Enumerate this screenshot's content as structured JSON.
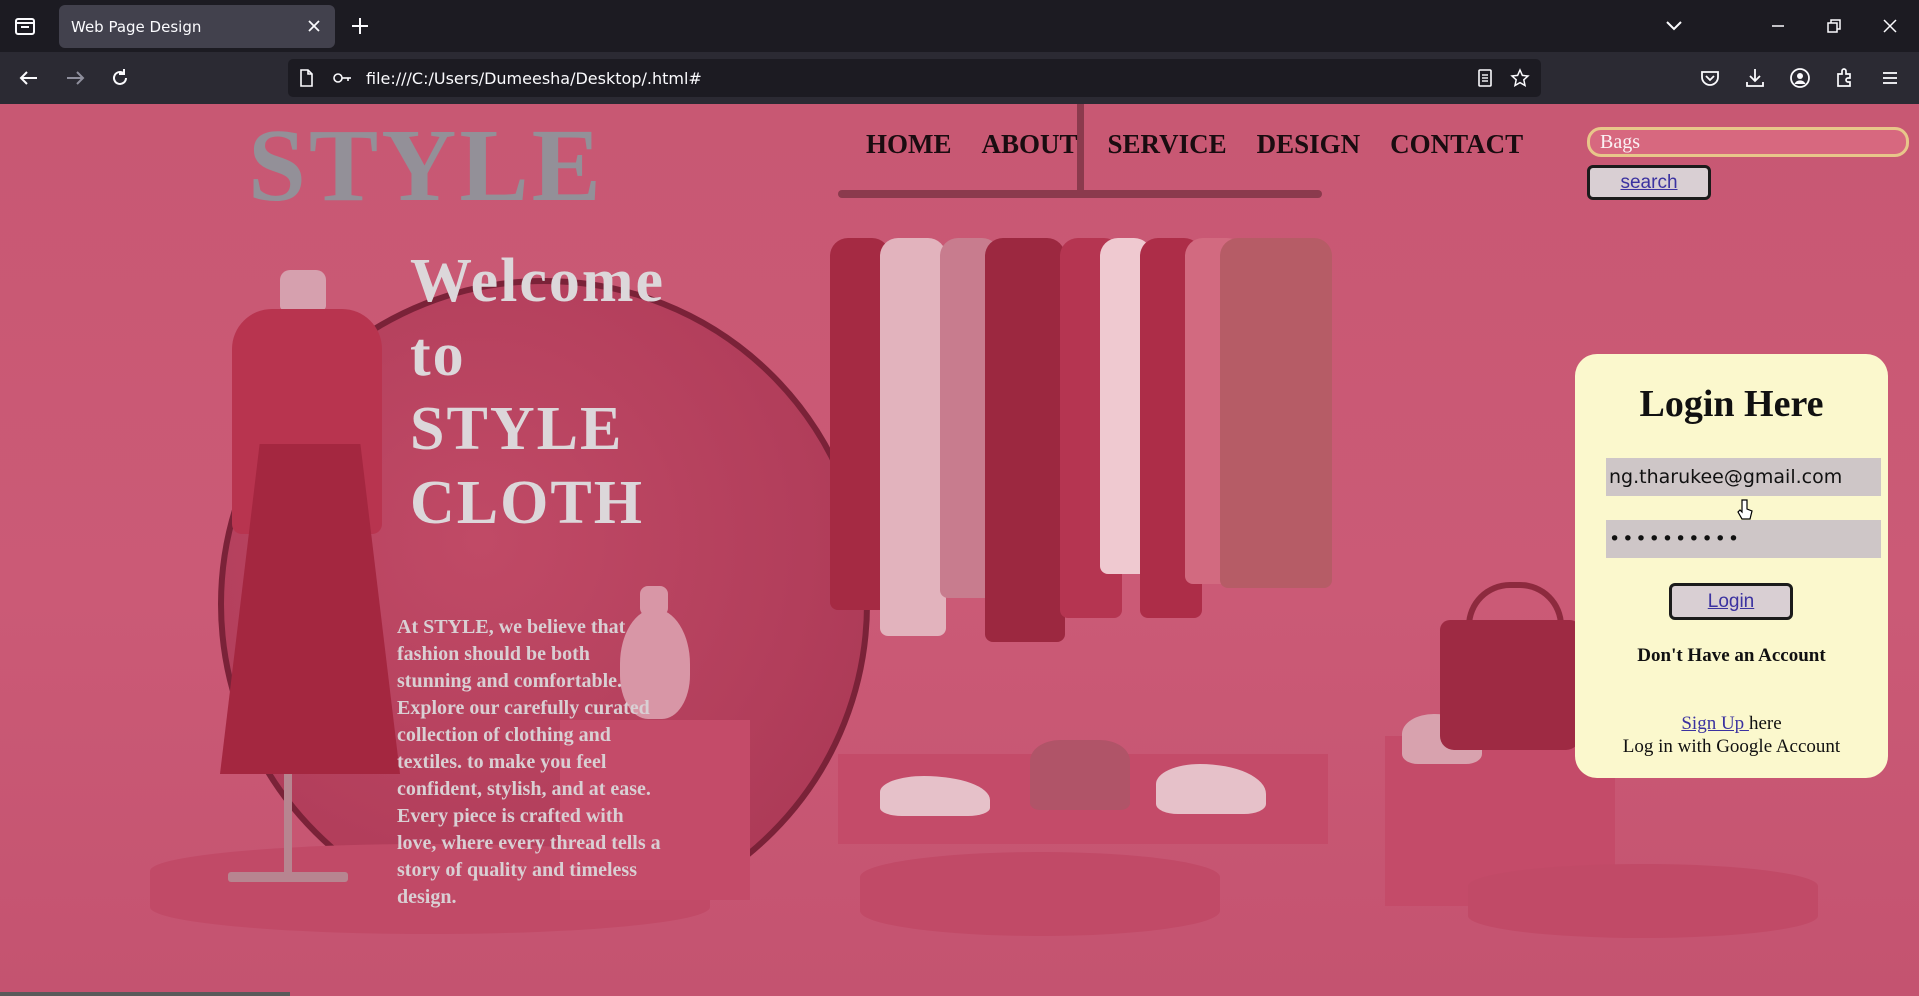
{
  "browser": {
    "tab_title": "Web Page Design",
    "url": "file:///C:/Users/Dumeesha/Desktop/.html#"
  },
  "site": {
    "logo": "STYLE",
    "nav": [
      "HOME",
      "ABOUT",
      "SERVICE",
      "DESIGN",
      "CONTACT"
    ],
    "search_value": "Bags",
    "search_button": "search"
  },
  "hero": {
    "welcome_lines": [
      "Welcome",
      "to",
      "STYLE",
      "CLOTH"
    ],
    "about_text": "At STYLE, we believe that fashion should be both stunning and comfortable. Explore our carefully curated collection of clothing and textiles. to make you feel confident, stylish, and at ease. Every piece is crafted with love, where every thread tells a story of quality and timeless design."
  },
  "login": {
    "title": "Login Here",
    "email_value": "ng.tharukee@gmail.com",
    "password_value": "••••••••••",
    "button": "Login",
    "no_account": "Don't Have an Account",
    "signup_link": "Sign Up ",
    "signup_suffix": "here",
    "google_text": "Log in with Google Account"
  },
  "colors": {
    "page_bg": "#c85873",
    "card_bg": "#fbf8cd",
    "link": "#3b32a0",
    "heading_grey": "#939098"
  }
}
